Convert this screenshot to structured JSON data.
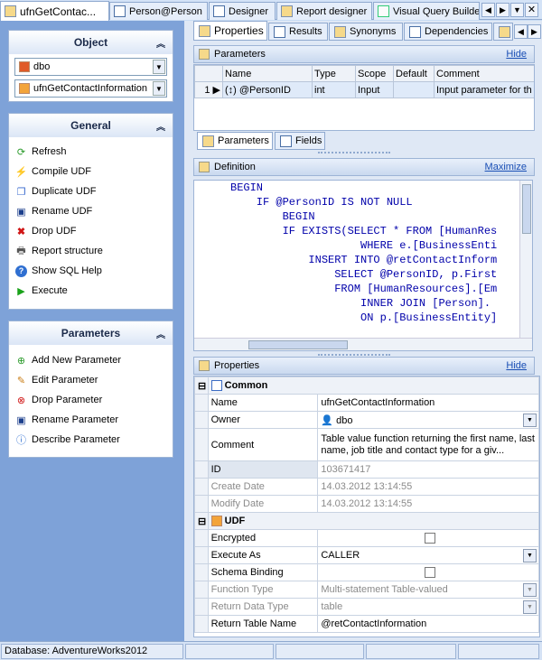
{
  "doc_tabs": [
    {
      "label": "ufnGetContac...",
      "icon": "function-icon"
    },
    {
      "label": "Person@Person",
      "icon": "table-icon"
    },
    {
      "label": "Designer",
      "icon": "designer-icon"
    },
    {
      "label": "Report designer",
      "icon": "report-icon"
    },
    {
      "label": "Visual Query Builde",
      "icon": "chart-icon"
    }
  ],
  "object_box": {
    "title": "Object",
    "database": "dbo",
    "object": "ufnGetContactInformation"
  },
  "general_box": {
    "title": "General",
    "items": [
      "Refresh",
      "Compile UDF",
      "Duplicate UDF",
      "Rename UDF",
      "Drop UDF",
      "Report structure",
      "Show SQL Help",
      "Execute"
    ]
  },
  "parameters_box": {
    "title": "Parameters",
    "items": [
      "Add New Parameter",
      "Edit Parameter",
      "Drop Parameter",
      "Rename Parameter",
      "Describe Parameter"
    ]
  },
  "right_tabs": [
    "Properties",
    "Results",
    "Synonyms",
    "Dependencies"
  ],
  "parameters_panel": {
    "title": "Parameters",
    "hide": "Hide",
    "columns": [
      "Name",
      "Type",
      "Scope",
      "Default",
      "Comment"
    ],
    "rows": [
      {
        "num": "1",
        "name": "@PersonID",
        "type": "int",
        "scope": "Input",
        "default": "",
        "comment": "Input parameter for th"
      }
    ],
    "subtabs": [
      "Parameters",
      "Fields"
    ]
  },
  "definition_panel": {
    "title": "Definition",
    "maximize": "Maximize",
    "lines": [
      "BEGIN",
      "    IF @PersonID IS NOT NULL",
      "        BEGIN",
      "        IF EXISTS(SELECT * FROM [HumanRes",
      "                    WHERE e.[BusinessEnti",
      "            INSERT INTO @retContactInform",
      "                SELECT @PersonID, p.First",
      "                FROM [HumanResources].[Em",
      "                    INNER JOIN [Person].",
      "                    ON p.[BusinessEntity]"
    ]
  },
  "properties_panel": {
    "title": "Properties",
    "hide": "Hide",
    "common_group": "Common",
    "udf_group": "UDF",
    "rows": [
      {
        "label": "Name",
        "value": "ufnGetContactInformation"
      },
      {
        "label": "Owner",
        "value": "dbo"
      },
      {
        "label": "Comment",
        "value": "Table value function returning the first name, last name, job title and contact type for a giv..."
      },
      {
        "label": "ID",
        "value": "103671417"
      },
      {
        "label": "Create Date",
        "value": "14.03.2012 13:14:55"
      },
      {
        "label": "Modify Date",
        "value": "14.03.2012 13:14:55"
      }
    ],
    "udf_rows": [
      {
        "label": "Encrypted",
        "value": ""
      },
      {
        "label": "Execute As",
        "value": "CALLER"
      },
      {
        "label": "Schema Binding",
        "value": ""
      },
      {
        "label": "Function Type",
        "value": "Multi-statement Table-valued"
      },
      {
        "label": "Return Data Type",
        "value": "table"
      },
      {
        "label": "Return Table Name",
        "value": "@retContactInformation"
      }
    ]
  },
  "status": {
    "database": "Database: AdventureWorks2012"
  },
  "colors": {
    "accent": "#7ea2d8",
    "link": "#1a4fb5",
    "sql_keyword": "#0000aa"
  }
}
